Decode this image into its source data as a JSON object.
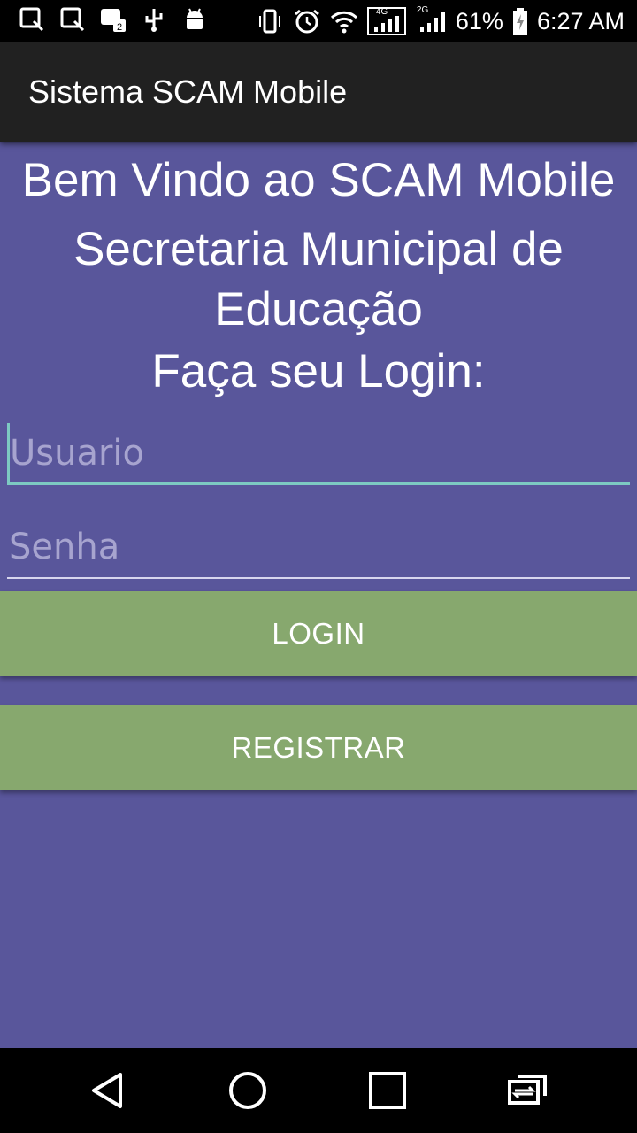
{
  "status_bar": {
    "battery": "61%",
    "time": "6:27 AM",
    "network_a": "4G",
    "network_b": "2G",
    "left_icons": [
      "search-notification-icon",
      "search-notification-icon",
      "sim-notification-icon",
      "usb-icon",
      "android-icon"
    ],
    "right_icons": [
      "vibrate-icon",
      "alarm-icon",
      "wifi-icon",
      "signal-4g-icon",
      "signal-2g-icon",
      "battery-charging-icon"
    ]
  },
  "app_bar": {
    "title": "Sistema SCAM Mobile"
  },
  "content": {
    "welcome": "Bem Vindo ao SCAM Mobile",
    "subtitle": "Secretaria Municipal de Educação",
    "prompt": "Faça seu Login:",
    "username_placeholder": "Usuario",
    "password_placeholder": "Senha",
    "login_label": "LOGIN",
    "register_label": "REGISTRAR"
  },
  "nav_bar": {
    "icons": [
      "back-icon",
      "home-icon",
      "recents-icon",
      "switch-app-icon"
    ]
  },
  "colors": {
    "background": "#59569b",
    "app_bar": "#212121",
    "button": "#87a86e",
    "focus_line": "#7dc9c2"
  }
}
